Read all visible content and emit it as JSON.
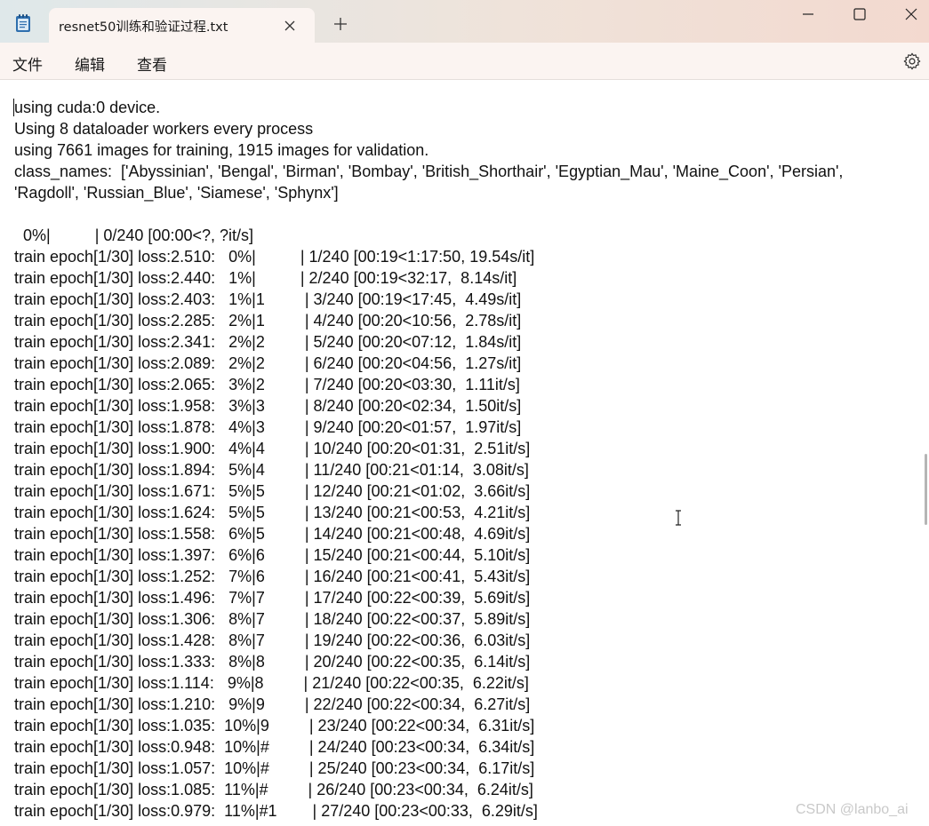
{
  "window": {
    "tab_title": "resnet50训练和验证过程.txt",
    "new_tab": "+"
  },
  "menu": {
    "file": "文件",
    "edit": "编辑",
    "view": "查看"
  },
  "icons": {
    "app": "notepad-icon",
    "settings": "gear-icon",
    "close_tab": "close-icon",
    "new_tab": "plus-icon",
    "minimize": "minimize-icon",
    "maximize": "maximize-icon",
    "close_window": "close-icon"
  },
  "document": {
    "lines": [
      "using cuda:0 device.",
      "Using 8 dataloader workers every process",
      "using 7661 images for training, 1915 images for validation.",
      "class_names:  ['Abyssinian', 'Bengal', 'Birman', 'Bombay', 'British_Shorthair', 'Egyptian_Mau', 'Maine_Coon', 'Persian',",
      "'Ragdoll', 'Russian_Blue', 'Siamese', 'Sphynx']",
      "",
      "  0%|          | 0/240 [00:00<?, ?it/s]",
      "train epoch[1/30] loss:2.510:   0%|          | 1/240 [00:19<1:17:50, 19.54s/it]",
      "train epoch[1/30] loss:2.440:   1%|          | 2/240 [00:19<32:17,  8.14s/it]",
      "train epoch[1/30] loss:2.403:   1%|1         | 3/240 [00:19<17:45,  4.49s/it]",
      "train epoch[1/30] loss:2.285:   2%|1         | 4/240 [00:20<10:56,  2.78s/it]",
      "train epoch[1/30] loss:2.341:   2%|2         | 5/240 [00:20<07:12,  1.84s/it]",
      "train epoch[1/30] loss:2.089:   2%|2         | 6/240 [00:20<04:56,  1.27s/it]",
      "train epoch[1/30] loss:2.065:   3%|2         | 7/240 [00:20<03:30,  1.11it/s]",
      "train epoch[1/30] loss:1.958:   3%|3         | 8/240 [00:20<02:34,  1.50it/s]",
      "train epoch[1/30] loss:1.878:   4%|3         | 9/240 [00:20<01:57,  1.97it/s]",
      "train epoch[1/30] loss:1.900:   4%|4         | 10/240 [00:20<01:31,  2.51it/s]",
      "train epoch[1/30] loss:1.894:   5%|4         | 11/240 [00:21<01:14,  3.08it/s]",
      "train epoch[1/30] loss:1.671:   5%|5         | 12/240 [00:21<01:02,  3.66it/s]",
      "train epoch[1/30] loss:1.624:   5%|5         | 13/240 [00:21<00:53,  4.21it/s]",
      "train epoch[1/30] loss:1.558:   6%|5         | 14/240 [00:21<00:48,  4.69it/s]",
      "train epoch[1/30] loss:1.397:   6%|6         | 15/240 [00:21<00:44,  5.10it/s]",
      "train epoch[1/30] loss:1.252:   7%|6         | 16/240 [00:21<00:41,  5.43it/s]",
      "train epoch[1/30] loss:1.496:   7%|7         | 17/240 [00:22<00:39,  5.69it/s]",
      "train epoch[1/30] loss:1.306:   8%|7         | 18/240 [00:22<00:37,  5.89it/s]",
      "train epoch[1/30] loss:1.428:   8%|7         | 19/240 [00:22<00:36,  6.03it/s]",
      "train epoch[1/30] loss:1.333:   8%|8         | 20/240 [00:22<00:35,  6.14it/s]",
      "train epoch[1/30] loss:1.114:   9%|8         | 21/240 [00:22<00:35,  6.22it/s]",
      "train epoch[1/30] loss:1.210:   9%|9         | 22/240 [00:22<00:34,  6.27it/s]",
      "train epoch[1/30] loss:1.035:  10%|9         | 23/240 [00:22<00:34,  6.31it/s]",
      "train epoch[1/30] loss:0.948:  10%|#         | 24/240 [00:23<00:34,  6.34it/s]",
      "train epoch[1/30] loss:1.057:  10%|#         | 25/240 [00:23<00:34,  6.17it/s]",
      "train epoch[1/30] loss:1.085:  11%|#         | 26/240 [00:23<00:34,  6.24it/s]",
      "train epoch[1/30] loss:0.979:  11%|#1        | 27/240 [00:23<00:33,  6.29it/s]"
    ]
  },
  "watermark": "CSDN @lanbo_ai"
}
